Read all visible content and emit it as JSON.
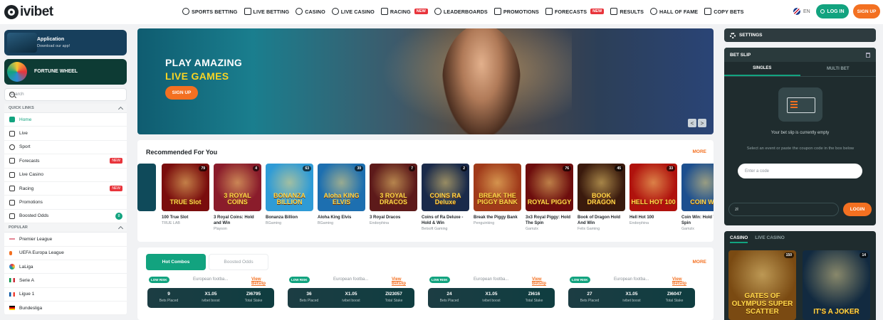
{
  "header": {
    "logo": "ivibet",
    "nav": [
      {
        "label": "SPORTS BETTING",
        "icon": "soccer-ball-icon",
        "new": ""
      },
      {
        "label": "LIVE BETTING",
        "icon": "live-icon",
        "new": ""
      },
      {
        "label": "CASINO",
        "icon": "casino-chip-icon",
        "new": ""
      },
      {
        "label": "LIVE CASINO",
        "icon": "live-casino-icon",
        "new": ""
      },
      {
        "label": "RACING",
        "icon": "horse-icon",
        "new": "NEW"
      },
      {
        "label": "LEADERBOARDS",
        "icon": "laurel-icon",
        "new": ""
      },
      {
        "label": "PROMOTIONS",
        "icon": "gift-icon",
        "new": ""
      },
      {
        "label": "FORECASTS",
        "icon": "forecast-icon",
        "new": "NEW"
      },
      {
        "label": "RESULTS",
        "icon": "results-icon",
        "new": ""
      },
      {
        "label": "HALL OF FAME",
        "icon": "crown-icon",
        "new": ""
      },
      {
        "label": "COPY BETS",
        "icon": "copy-icon",
        "new": ""
      }
    ],
    "lang": "EN",
    "login": "LOG IN",
    "signup": "SIGN UP"
  },
  "sidebar": {
    "promo_app_title": "Application",
    "promo_app_sub": "Download our app!",
    "promo_wheel_title": "FORTUNE WHEEL",
    "search_placeholder": "Search",
    "quick_links_title": "QUICK LINKS",
    "quick_links": [
      {
        "label": "Home",
        "badge": "",
        "count": ""
      },
      {
        "label": "Live",
        "badge": "",
        "count": ""
      },
      {
        "label": "Sport",
        "badge": "",
        "count": ""
      },
      {
        "label": "Forecasts",
        "badge": "NEW",
        "count": ""
      },
      {
        "label": "Live Casino",
        "badge": "",
        "count": ""
      },
      {
        "label": "Racing",
        "badge": "NEW",
        "count": ""
      },
      {
        "label": "Promotions",
        "badge": "",
        "count": ""
      },
      {
        "label": "Boosted Odds",
        "badge": "",
        "count": "8"
      }
    ],
    "popular_title": "POPULAR",
    "popular": [
      {
        "label": "Premier League"
      },
      {
        "label": "UEFA Europa League"
      },
      {
        "label": "LaLiga"
      },
      {
        "label": "Serie A"
      },
      {
        "label": "Ligue 1"
      },
      {
        "label": "Bundesliga"
      }
    ]
  },
  "hero": {
    "title": "PLAY AMAZING",
    "subtitle": "LIVE GAMES",
    "button": "SIGN UP",
    "prev": "<",
    "next": ">"
  },
  "recommended": {
    "title": "Recommended For You",
    "more": "MORE",
    "games": [
      {
        "name": "100 True Slot",
        "provider": "TRUE LAB",
        "players": "79",
        "art": "TRUE Slot",
        "bg": "#7a0d0d"
      },
      {
        "name": "3 Royal Coins: Hold and Win",
        "provider": "Playson",
        "players": "4",
        "art": "3 ROYAL COINS",
        "bg": "#8a1c2b"
      },
      {
        "name": "Bonanza Billion",
        "provider": "BGaming",
        "players": "63",
        "art": "BONANZA BILLION",
        "bg": "#2f9bd6"
      },
      {
        "name": "Aloha King Elvis",
        "provider": "BGaming",
        "players": "39",
        "art": "Aloha KING ELVIS",
        "bg": "#1d6fb0"
      },
      {
        "name": "3 Royal Dracos",
        "provider": "Endorphina",
        "players": "7",
        "art": "3 ROYAL DRACOS",
        "bg": "#5d1a1a"
      },
      {
        "name": "Coins of Ra Deluxe - Hold & Win",
        "provider": "Betsoft Gaming",
        "players": "2",
        "art": "COINS RA Deluxe",
        "bg": "#1a2a4a"
      },
      {
        "name": "Break the Piggy Bank",
        "provider": "Penguinking",
        "players": "",
        "art": "BREAK THE PIGGY BANK",
        "bg": "#a03a1a"
      },
      {
        "name": "3x3 Royal Piggy: Hold The Spin",
        "provider": "Gamzix",
        "players": "76",
        "art": "ROYAL PIGGY",
        "bg": "#6d0d0d"
      },
      {
        "name": "Book of Dragon Hold And Win",
        "provider": "Felix Gaming",
        "players": "45",
        "art": "BOOK DRAGON",
        "bg": "#3a1a0d"
      },
      {
        "name": "Hell Hot 100",
        "provider": "Endorphina",
        "players": "33",
        "art": "HELL HOT 100",
        "bg": "#b0120d"
      },
      {
        "name": "Coin Win: Hold The Spin",
        "provider": "Gamzix",
        "players": "",
        "art": "COIN WIN",
        "bg": "#1c4f8f"
      }
    ]
  },
  "hot": {
    "tab_hot": "Hot Combos",
    "tab_boosted": "Boosted Odds",
    "more": "MORE",
    "combos": [
      {
        "risk": "LOW RISK",
        "league": "European footba...",
        "view": "View Betslip",
        "bets": "9",
        "boost": "X1.05",
        "stake": "Zł6795",
        "bets_label": "Bets Placed",
        "boost_label": "ivibet boost",
        "stake_label": "Total Stake"
      },
      {
        "risk": "LOW RISK",
        "league": "European footba...",
        "view": "View Betslip",
        "bets": "36",
        "boost": "X1.05",
        "stake": "Zł23057",
        "bets_label": "Bets Placed",
        "boost_label": "ivibet boost",
        "stake_label": "Total Stake"
      },
      {
        "risk": "LOW RISK",
        "league": "European footba...",
        "view": "View Betslip",
        "bets": "24",
        "boost": "X1.05",
        "stake": "Zł616",
        "bets_label": "Bets Placed",
        "boost_label": "ivibet boost",
        "stake_label": "Total Stake"
      },
      {
        "risk": "LOW RISK",
        "league": "European footba...",
        "view": "View Betslip",
        "bets": "27",
        "boost": "X1.05",
        "stake": "Zł6047",
        "bets_label": "Bets Placed",
        "boost_label": "ivibet boost",
        "stake_label": "Total Stake"
      }
    ]
  },
  "right": {
    "settings": "SETTINGS",
    "betslip_title": "BET SLIP",
    "tab_singles": "SINGLES",
    "tab_multi": "MULTI BET",
    "empty": "Your bet slip is currently empty",
    "help": "Select an event or paste the coupon code in the box below",
    "code_placeholder": "Enter a code",
    "currency": "zł",
    "login": "LOGIN",
    "casino_tab": "CASINO",
    "live_casino_tab": "LIVE CASINO",
    "casino_games": [
      {
        "art": "GATES OF OLYMPUS SUPER SCATTER",
        "players": "150",
        "bg": "#7a4a12"
      },
      {
        "art": "IT'S A JOKER",
        "players": "14",
        "bg": "#122a40"
      }
    ]
  },
  "colors": {
    "accent": "#12a37f",
    "orange": "#f37021",
    "dark": "#1f2c2e"
  }
}
